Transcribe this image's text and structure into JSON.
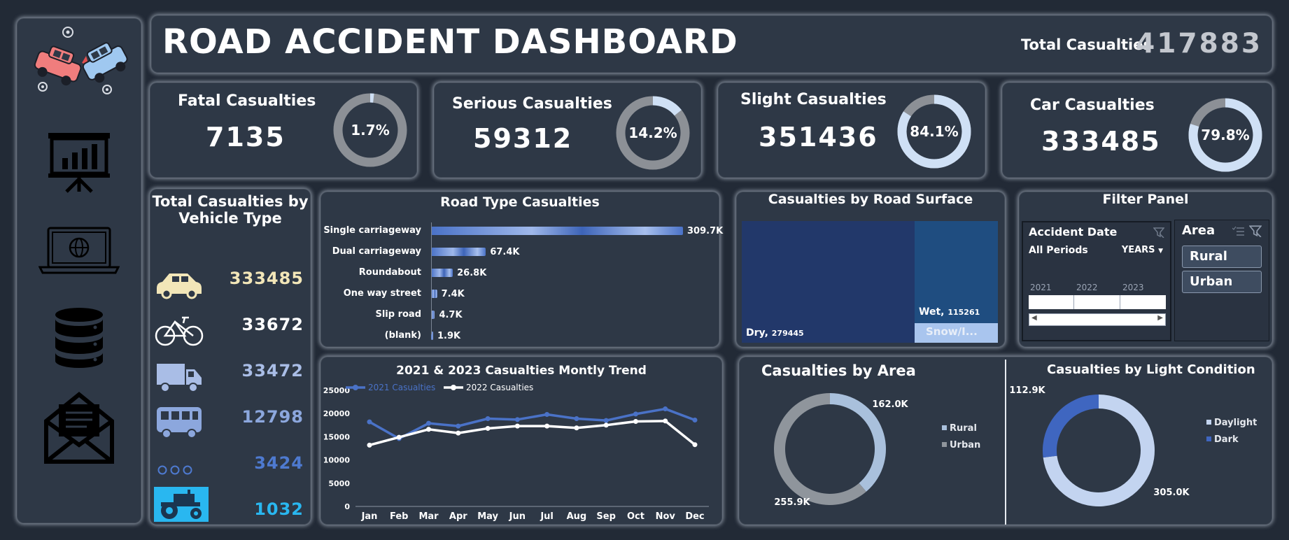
{
  "header": {
    "title": "ROAD ACCIDENT DASHBOARD",
    "total_label": "Total Casualties",
    "total_value": "417883"
  },
  "sidebar": {
    "items": [
      {
        "icon": "accident-logo-icon"
      },
      {
        "icon": "presentation-chart-icon"
      },
      {
        "icon": "laptop-globe-icon"
      },
      {
        "icon": "database-icon"
      },
      {
        "icon": "mail-envelope-icon"
      }
    ]
  },
  "kpis": [
    {
      "label": "Fatal Casualties",
      "value": "7135",
      "pct_label": "1.7%",
      "pct": 0.017
    },
    {
      "label": "Serious Casualties",
      "value": "59312",
      "pct_label": "14.2%",
      "pct": 0.142
    },
    {
      "label": "Slight Casualties",
      "value": "351436",
      "pct_label": "84.1%",
      "pct": 0.841
    },
    {
      "label": "Car Casualties",
      "value": "333485",
      "pct_label": "79.8%",
      "pct": 0.798
    }
  ],
  "vehicle": {
    "title_line1": "Total Casualties by",
    "title_line2": "Vehicle Type",
    "items": [
      {
        "icon": "car-icon",
        "value": "333485",
        "color": "#f2e6b8"
      },
      {
        "icon": "bicycle-icon",
        "value": "33672",
        "color": "#ffffff"
      },
      {
        "icon": "truck-icon",
        "value": "33472",
        "color": "#a9bde6"
      },
      {
        "icon": "bus-icon",
        "value": "12798",
        "color": "#8ca7dd"
      },
      {
        "icon": "other-dots-icon",
        "value": "3424",
        "color": "#4e7ad0"
      },
      {
        "icon": "tractor-icon",
        "value": "1032",
        "color": "#29b7f0"
      }
    ]
  },
  "road_type": {
    "title": "Road Type Casualties",
    "chart_data": {
      "type": "bar",
      "orientation": "horizontal",
      "categories": [
        "Single carriageway",
        "Dual carriageway",
        "Roundabout",
        "One way street",
        "Slip road",
        "(blank)"
      ],
      "values": [
        309.7,
        67.4,
        26.8,
        7.4,
        4.7,
        1.9
      ],
      "value_labels": [
        "309.7K",
        "67.4K",
        "26.8K",
        "7.4K",
        "4.7K",
        "1.9K"
      ],
      "max": 309.7
    }
  },
  "surface": {
    "title": "Casualties by Road Surface",
    "chart_data": {
      "type": "treemap",
      "items": [
        {
          "name": "Dry",
          "label": "279445",
          "value": 279445,
          "color": "#22386a"
        },
        {
          "name": "Wet",
          "label": "115261",
          "value": 115261,
          "color": "#1f4d80"
        },
        {
          "name": "Snow/I...",
          "label": "",
          "value": 23177,
          "color": "#a9c5ee"
        }
      ]
    }
  },
  "filter": {
    "title": "Filter Panel",
    "date_label": "Accident Date",
    "all_periods": "All Periods",
    "period_unit": "YEARS",
    "years": [
      "2021",
      "2022",
      "2023"
    ],
    "area_label": "Area",
    "area_options": [
      "Rural",
      "Urban"
    ]
  },
  "trend": {
    "title": "2021 & 2023 Casualties Montly Trend",
    "chart_data": {
      "type": "line",
      "categories": [
        "Jan",
        "Feb",
        "Mar",
        "Apr",
        "May",
        "Jun",
        "Jul",
        "Aug",
        "Sep",
        "Oct",
        "Nov",
        "Dec"
      ],
      "yticks": [
        "25000",
        "20000",
        "15000",
        "10000",
        "5000",
        "0"
      ],
      "ylim": [
        0,
        25000
      ],
      "series": [
        {
          "name": "2021 Casualties",
          "color": "#4a72c7",
          "values": [
            18200,
            14600,
            17900,
            17300,
            18900,
            18700,
            19800,
            18900,
            18500,
            19900,
            21000,
            18600
          ]
        },
        {
          "name": "2022 Casualties",
          "color": "#ffffff",
          "values": [
            13200,
            14900,
            16600,
            15800,
            16800,
            17300,
            17300,
            16900,
            17500,
            18300,
            18400,
            13300
          ]
        }
      ]
    }
  },
  "area_chart": {
    "title": "Casualties by Area",
    "chart_data": {
      "type": "pie",
      "donut": true,
      "items": [
        {
          "name": "Rural",
          "value": 162.0,
          "label": "162.0K",
          "color": "#a9c0dc"
        },
        {
          "name": "Urban",
          "value": 255.9,
          "label": "255.9K",
          "color": "#8f959c"
        }
      ]
    }
  },
  "light_chart": {
    "title": "Casualties by Light Condition",
    "chart_data": {
      "type": "pie",
      "donut": true,
      "items": [
        {
          "name": "Daylight",
          "value": 305.0,
          "label": "305.0K",
          "color": "#c3d4f0"
        },
        {
          "name": "Dark",
          "value": 112.9,
          "label": "112.9K",
          "color": "#3f66c0"
        }
      ]
    }
  }
}
